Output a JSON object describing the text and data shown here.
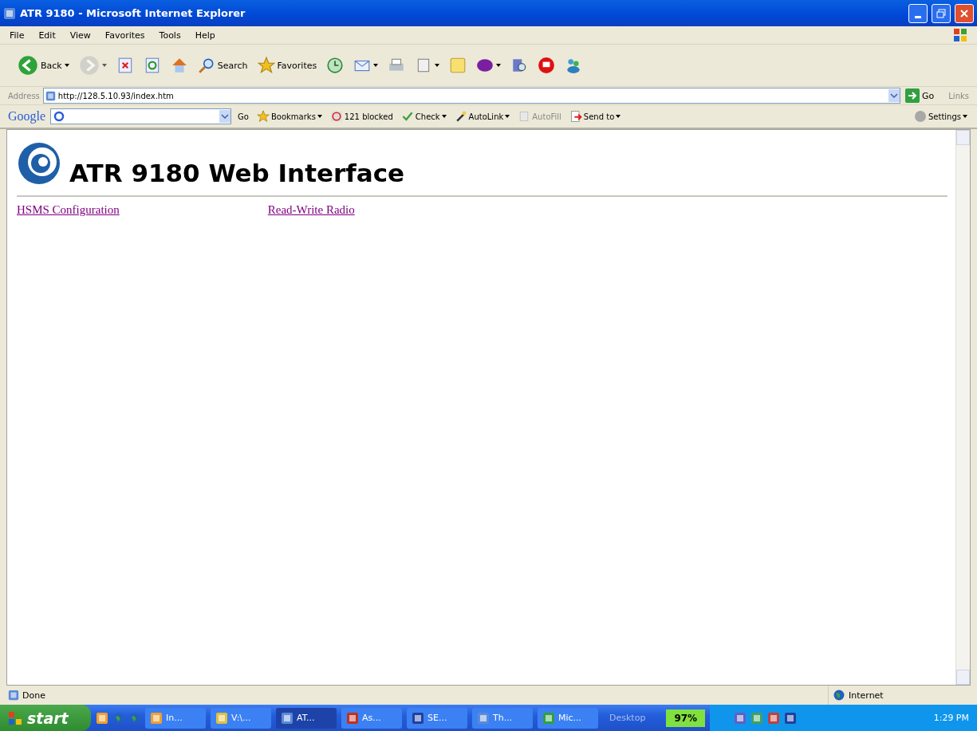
{
  "window": {
    "title": "ATR 9180 - Microsoft Internet Explorer"
  },
  "menu": [
    "File",
    "Edit",
    "View",
    "Favorites",
    "Tools",
    "Help"
  ],
  "toolbar": [
    {
      "kind": "back",
      "label": "Back",
      "dropdown": true
    },
    {
      "kind": "forward",
      "dropdown": true,
      "disabled": true
    },
    {
      "kind": "stop"
    },
    {
      "kind": "refresh"
    },
    {
      "kind": "home"
    },
    {
      "kind": "search",
      "label": "Search"
    },
    {
      "kind": "star",
      "label": "Favorites"
    },
    {
      "kind": "history"
    },
    {
      "kind": "mail",
      "dropdown": true
    },
    {
      "kind": "printer"
    },
    {
      "kind": "document",
      "dropdown": true
    },
    {
      "kind": "note"
    },
    {
      "kind": "yahoo",
      "dropdown": true
    },
    {
      "kind": "magnifier"
    },
    {
      "kind": "monitor"
    },
    {
      "kind": "people"
    }
  ],
  "address": {
    "label": "Address",
    "value": "http://128.5.10.93/index.htm",
    "go": "Go",
    "links": "Links"
  },
  "google_bar": {
    "logo": "Google",
    "go": "Go",
    "items": [
      {
        "kind": "star",
        "label": "Bookmarks",
        "dropdown": true,
        "disabled": false
      },
      {
        "kind": "blocked",
        "label": "121 blocked",
        "dropdown": false,
        "disabled": false
      },
      {
        "kind": "check",
        "label": "Check",
        "dropdown": true,
        "disabled": false
      },
      {
        "kind": "wand",
        "label": "AutoLink",
        "dropdown": true,
        "disabled": false
      },
      {
        "kind": "form",
        "label": "AutoFill",
        "dropdown": false,
        "disabled": true
      },
      {
        "kind": "send",
        "label": "Send to",
        "dropdown": true,
        "disabled": false
      }
    ],
    "settings": "Settings"
  },
  "page": {
    "heading": "ATR 9180 Web Interface",
    "links": [
      "HSMS Configuration",
      "Read-Write Radio"
    ]
  },
  "status_bar": {
    "text": "Done",
    "zone": "Internet"
  },
  "taskbar": {
    "start": "start",
    "buttons": [
      {
        "label": "In...",
        "selected": false
      },
      {
        "label": "V:\\...",
        "selected": false
      },
      {
        "label": "AT...",
        "selected": true
      },
      {
        "label": "As...",
        "selected": false
      },
      {
        "label": "SE...",
        "selected": false
      },
      {
        "label": "Th...",
        "selected": false
      },
      {
        "label": "Mic...",
        "selected": false
      }
    ],
    "desktop": "Desktop",
    "battery": "97%",
    "clock": "1:29 PM"
  }
}
